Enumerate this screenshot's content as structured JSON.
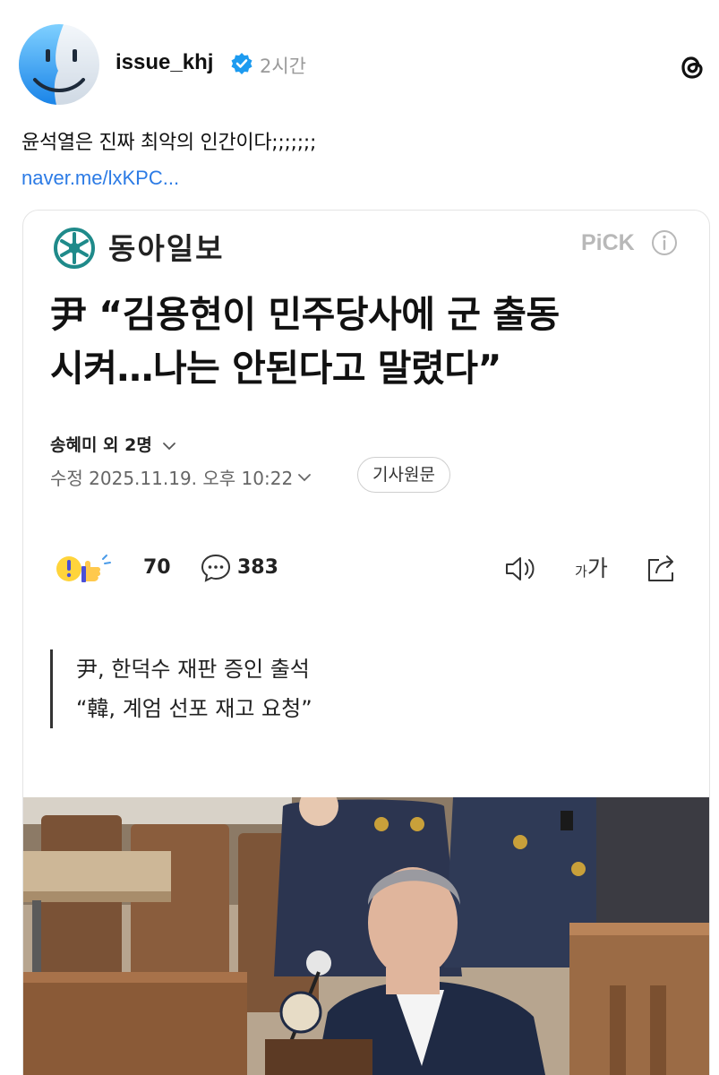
{
  "post": {
    "author_handle": "issue_khj",
    "time_ago": "2시간",
    "text": "윤석열은 진짜 최악의 인간이다;;;;;;;",
    "link": "naver.me/lxKPC..."
  },
  "article": {
    "publisher": "동아일보",
    "pick_label": "PiCK",
    "headline_line1": "尹 “김용현이 민주당사에 군 출동",
    "headline_line2": "시켜…나는 안된다고 말렸다”",
    "authors": "송혜미 외 2명",
    "dateline": "수정 2025.11.19. 오후 10:22",
    "original_button": "기사원문",
    "reaction_count": "70",
    "comment_count": "383",
    "font_small": "가",
    "font_big": "가",
    "summary": [
      "尹, 한덕수 재판 증인 출석",
      "“韓, 계엄 선포 재고 요청”"
    ]
  },
  "colors": {
    "link": "#2c7be5",
    "verified": "#1d9bf0",
    "logo": "#1f8a8a"
  },
  "icons": [
    "finder-avatar-icon",
    "verified-badge-icon",
    "threads-logo-icon",
    "donga-logo-icon",
    "info-icon",
    "reaction-emoji-icon",
    "comment-icon",
    "speaker-icon",
    "share-icon",
    "chevron-down-icon"
  ]
}
